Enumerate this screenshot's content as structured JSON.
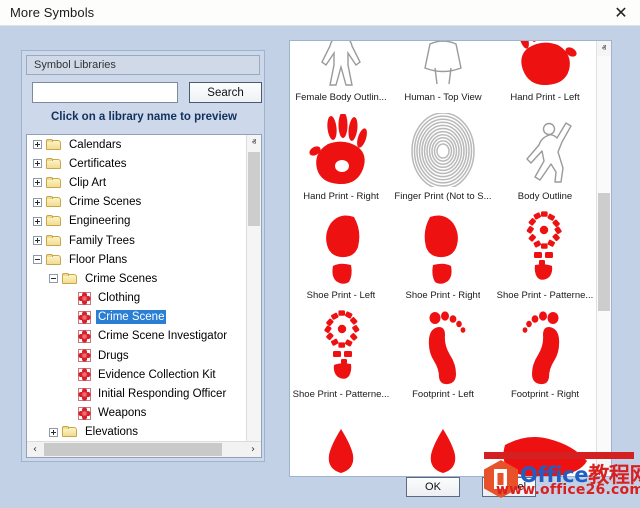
{
  "window": {
    "title": "More Symbols",
    "close_icon": "close-icon",
    "close_label": "✕"
  },
  "left_panel": {
    "group_header": "Symbol Libraries",
    "search": {
      "value": "",
      "placeholder": "",
      "button_label": "Search"
    },
    "hint": "Click on a library name to preview",
    "tree": [
      {
        "label": "Calendars",
        "depth": 0,
        "icon": "folder-icon",
        "expander": "plus",
        "selected": false
      },
      {
        "label": "Certificates",
        "depth": 0,
        "icon": "folder-icon",
        "expander": "plus",
        "selected": false
      },
      {
        "label": "Clip Art",
        "depth": 0,
        "icon": "folder-icon",
        "expander": "plus",
        "selected": false
      },
      {
        "label": "Crime Scenes",
        "depth": 0,
        "icon": "folder-icon",
        "expander": "plus",
        "selected": false
      },
      {
        "label": "Engineering",
        "depth": 0,
        "icon": "folder-icon",
        "expander": "plus",
        "selected": false
      },
      {
        "label": "Family Trees",
        "depth": 0,
        "icon": "folder-icon",
        "expander": "plus",
        "selected": false
      },
      {
        "label": "Floor Plans",
        "depth": 0,
        "icon": "folder-icon",
        "expander": "minus",
        "selected": false
      },
      {
        "label": "Crime Scenes",
        "depth": 1,
        "icon": "folder-icon",
        "expander": "minus",
        "selected": false
      },
      {
        "label": "Clothing",
        "depth": 2,
        "icon": "library-icon",
        "expander": "none",
        "selected": false
      },
      {
        "label": "Crime Scene",
        "depth": 2,
        "icon": "library-icon",
        "expander": "none",
        "selected": true
      },
      {
        "label": "Crime Scene Investigator",
        "depth": 2,
        "icon": "library-icon",
        "expander": "none",
        "selected": false
      },
      {
        "label": "Drugs",
        "depth": 2,
        "icon": "library-icon",
        "expander": "none",
        "selected": false
      },
      {
        "label": "Evidence Collection Kit",
        "depth": 2,
        "icon": "library-icon",
        "expander": "none",
        "selected": false
      },
      {
        "label": "Initial Responding Officer",
        "depth": 2,
        "icon": "library-icon",
        "expander": "none",
        "selected": false
      },
      {
        "label": "Weapons",
        "depth": 2,
        "icon": "library-icon",
        "expander": "none",
        "selected": false
      },
      {
        "label": "Elevations",
        "depth": 1,
        "icon": "folder-icon",
        "expander": "plus",
        "selected": false
      }
    ],
    "scrollbars": {
      "v_up_icon": "chevron-up-icon",
      "v_up_label": "ⱏ",
      "v_down_icon": "chevron-down-icon",
      "v_down_label": "ⱟ",
      "h_left_icon": "chevron-left-icon",
      "h_left_label": "‹",
      "h_right_icon": "chevron-right-icon",
      "h_right_label": "›"
    }
  },
  "preview_panel": {
    "rows": [
      [
        {
          "label": "Female Body Outlin...",
          "art": "female-body-outline"
        },
        {
          "label": "Human - Top View",
          "art": "human-top-view"
        },
        {
          "label": "Hand Print - Left",
          "art": "hand-print-left"
        }
      ],
      [
        {
          "label": "Hand Print - Right",
          "art": "hand-print-right"
        },
        {
          "label": "Finger Print (Not to S...",
          "art": "finger-print"
        },
        {
          "label": "Body Outline",
          "art": "body-outline"
        }
      ],
      [
        {
          "label": "Shoe Print - Left",
          "art": "shoe-print-left"
        },
        {
          "label": "Shoe Print - Right",
          "art": "shoe-print-right"
        },
        {
          "label": "Shoe Print - Patterne...",
          "art": "shoe-print-patterned-right"
        }
      ],
      [
        {
          "label": "Shoe Print - Patterne...",
          "art": "shoe-print-patterned-left"
        },
        {
          "label": "Footprint - Left",
          "art": "footprint-left"
        },
        {
          "label": "Footprint - Right",
          "art": "footprint-right"
        }
      ],
      [
        {
          "label": "",
          "art": "blood-drop-left"
        },
        {
          "label": "",
          "art": "blood-drop-right"
        },
        {
          "label": "",
          "art": "blood-pool"
        }
      ]
    ],
    "scrollbars": {
      "v_up_icon": "chevron-up-icon",
      "v_up_label": "ⱏ",
      "v_down_icon": "chevron-down-icon",
      "v_down_label": "ⱟ"
    }
  },
  "footer": {
    "ok_label": "OK",
    "cancel_label": "Cancel"
  },
  "watermark": {
    "brand_en": "Office",
    "brand_cn": "教程网",
    "url": "www.office26.com"
  },
  "colors": {
    "dialog_background": "#c3d1e6",
    "selection_blue": "#2a7fd4",
    "symbol_red": "#ee1111",
    "watermark_blue": "#1f5fc4",
    "watermark_red": "#d82020",
    "office_orange": "#e8522a"
  }
}
